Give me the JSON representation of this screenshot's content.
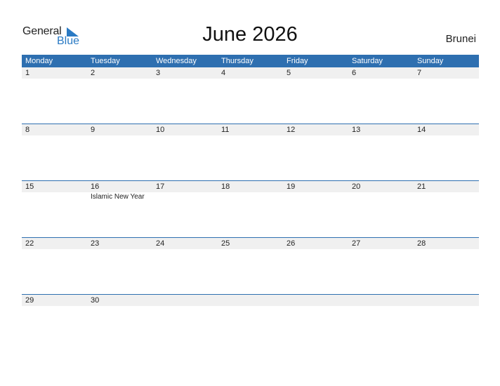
{
  "logo": {
    "text1": "General",
    "text2": "Blue"
  },
  "title": "June 2026",
  "country": "Brunei",
  "colors": {
    "header": "#2e6fb0",
    "brand": "#2a7ac4",
    "day_row": "#f0f0f0"
  },
  "weekdays": [
    "Monday",
    "Tuesday",
    "Wednesday",
    "Thursday",
    "Friday",
    "Saturday",
    "Sunday"
  ],
  "weeks": [
    {
      "days": [
        "1",
        "2",
        "3",
        "4",
        "5",
        "6",
        "7"
      ],
      "events": [
        "",
        "",
        "",
        "",
        "",
        "",
        ""
      ]
    },
    {
      "days": [
        "8",
        "9",
        "10",
        "11",
        "12",
        "13",
        "14"
      ],
      "events": [
        "",
        "",
        "",
        "",
        "",
        "",
        ""
      ]
    },
    {
      "days": [
        "15",
        "16",
        "17",
        "18",
        "19",
        "20",
        "21"
      ],
      "events": [
        "",
        "Islamic New Year",
        "",
        "",
        "",
        "",
        ""
      ]
    },
    {
      "days": [
        "22",
        "23",
        "24",
        "25",
        "26",
        "27",
        "28"
      ],
      "events": [
        "",
        "",
        "",
        "",
        "",
        "",
        ""
      ]
    },
    {
      "days": [
        "29",
        "30",
        "",
        "",
        "",
        "",
        ""
      ],
      "events": [
        "",
        "",
        "",
        "",
        "",
        "",
        ""
      ]
    }
  ]
}
